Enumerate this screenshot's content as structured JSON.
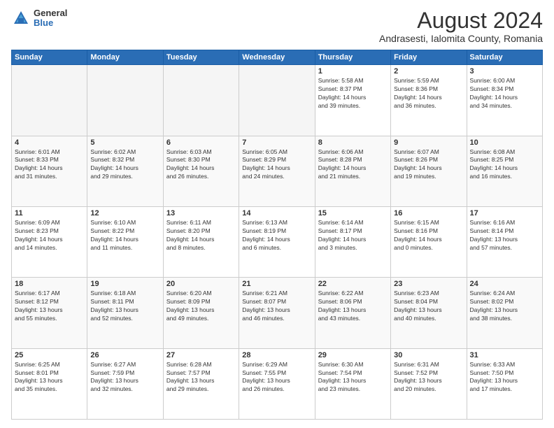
{
  "logo": {
    "general": "General",
    "blue": "Blue"
  },
  "title": {
    "month_year": "August 2024",
    "location": "Andrasesti, Ialomita County, Romania"
  },
  "days_of_week": [
    "Sunday",
    "Monday",
    "Tuesday",
    "Wednesday",
    "Thursday",
    "Friday",
    "Saturday"
  ],
  "weeks": [
    [
      {
        "day": "",
        "info": ""
      },
      {
        "day": "",
        "info": ""
      },
      {
        "day": "",
        "info": ""
      },
      {
        "day": "",
        "info": ""
      },
      {
        "day": "1",
        "info": "Sunrise: 5:58 AM\nSunset: 8:37 PM\nDaylight: 14 hours\nand 39 minutes."
      },
      {
        "day": "2",
        "info": "Sunrise: 5:59 AM\nSunset: 8:36 PM\nDaylight: 14 hours\nand 36 minutes."
      },
      {
        "day": "3",
        "info": "Sunrise: 6:00 AM\nSunset: 8:34 PM\nDaylight: 14 hours\nand 34 minutes."
      }
    ],
    [
      {
        "day": "4",
        "info": "Sunrise: 6:01 AM\nSunset: 8:33 PM\nDaylight: 14 hours\nand 31 minutes."
      },
      {
        "day": "5",
        "info": "Sunrise: 6:02 AM\nSunset: 8:32 PM\nDaylight: 14 hours\nand 29 minutes."
      },
      {
        "day": "6",
        "info": "Sunrise: 6:03 AM\nSunset: 8:30 PM\nDaylight: 14 hours\nand 26 minutes."
      },
      {
        "day": "7",
        "info": "Sunrise: 6:05 AM\nSunset: 8:29 PM\nDaylight: 14 hours\nand 24 minutes."
      },
      {
        "day": "8",
        "info": "Sunrise: 6:06 AM\nSunset: 8:28 PM\nDaylight: 14 hours\nand 21 minutes."
      },
      {
        "day": "9",
        "info": "Sunrise: 6:07 AM\nSunset: 8:26 PM\nDaylight: 14 hours\nand 19 minutes."
      },
      {
        "day": "10",
        "info": "Sunrise: 6:08 AM\nSunset: 8:25 PM\nDaylight: 14 hours\nand 16 minutes."
      }
    ],
    [
      {
        "day": "11",
        "info": "Sunrise: 6:09 AM\nSunset: 8:23 PM\nDaylight: 14 hours\nand 14 minutes."
      },
      {
        "day": "12",
        "info": "Sunrise: 6:10 AM\nSunset: 8:22 PM\nDaylight: 14 hours\nand 11 minutes."
      },
      {
        "day": "13",
        "info": "Sunrise: 6:11 AM\nSunset: 8:20 PM\nDaylight: 14 hours\nand 8 minutes."
      },
      {
        "day": "14",
        "info": "Sunrise: 6:13 AM\nSunset: 8:19 PM\nDaylight: 14 hours\nand 6 minutes."
      },
      {
        "day": "15",
        "info": "Sunrise: 6:14 AM\nSunset: 8:17 PM\nDaylight: 14 hours\nand 3 minutes."
      },
      {
        "day": "16",
        "info": "Sunrise: 6:15 AM\nSunset: 8:16 PM\nDaylight: 14 hours\nand 0 minutes."
      },
      {
        "day": "17",
        "info": "Sunrise: 6:16 AM\nSunset: 8:14 PM\nDaylight: 13 hours\nand 57 minutes."
      }
    ],
    [
      {
        "day": "18",
        "info": "Sunrise: 6:17 AM\nSunset: 8:12 PM\nDaylight: 13 hours\nand 55 minutes."
      },
      {
        "day": "19",
        "info": "Sunrise: 6:18 AM\nSunset: 8:11 PM\nDaylight: 13 hours\nand 52 minutes."
      },
      {
        "day": "20",
        "info": "Sunrise: 6:20 AM\nSunset: 8:09 PM\nDaylight: 13 hours\nand 49 minutes."
      },
      {
        "day": "21",
        "info": "Sunrise: 6:21 AM\nSunset: 8:07 PM\nDaylight: 13 hours\nand 46 minutes."
      },
      {
        "day": "22",
        "info": "Sunrise: 6:22 AM\nSunset: 8:06 PM\nDaylight: 13 hours\nand 43 minutes."
      },
      {
        "day": "23",
        "info": "Sunrise: 6:23 AM\nSunset: 8:04 PM\nDaylight: 13 hours\nand 40 minutes."
      },
      {
        "day": "24",
        "info": "Sunrise: 6:24 AM\nSunset: 8:02 PM\nDaylight: 13 hours\nand 38 minutes."
      }
    ],
    [
      {
        "day": "25",
        "info": "Sunrise: 6:25 AM\nSunset: 8:01 PM\nDaylight: 13 hours\nand 35 minutes."
      },
      {
        "day": "26",
        "info": "Sunrise: 6:27 AM\nSunset: 7:59 PM\nDaylight: 13 hours\nand 32 minutes."
      },
      {
        "day": "27",
        "info": "Sunrise: 6:28 AM\nSunset: 7:57 PM\nDaylight: 13 hours\nand 29 minutes."
      },
      {
        "day": "28",
        "info": "Sunrise: 6:29 AM\nSunset: 7:55 PM\nDaylight: 13 hours\nand 26 minutes."
      },
      {
        "day": "29",
        "info": "Sunrise: 6:30 AM\nSunset: 7:54 PM\nDaylight: 13 hours\nand 23 minutes."
      },
      {
        "day": "30",
        "info": "Sunrise: 6:31 AM\nSunset: 7:52 PM\nDaylight: 13 hours\nand 20 minutes."
      },
      {
        "day": "31",
        "info": "Sunrise: 6:33 AM\nSunset: 7:50 PM\nDaylight: 13 hours\nand 17 minutes."
      }
    ]
  ]
}
